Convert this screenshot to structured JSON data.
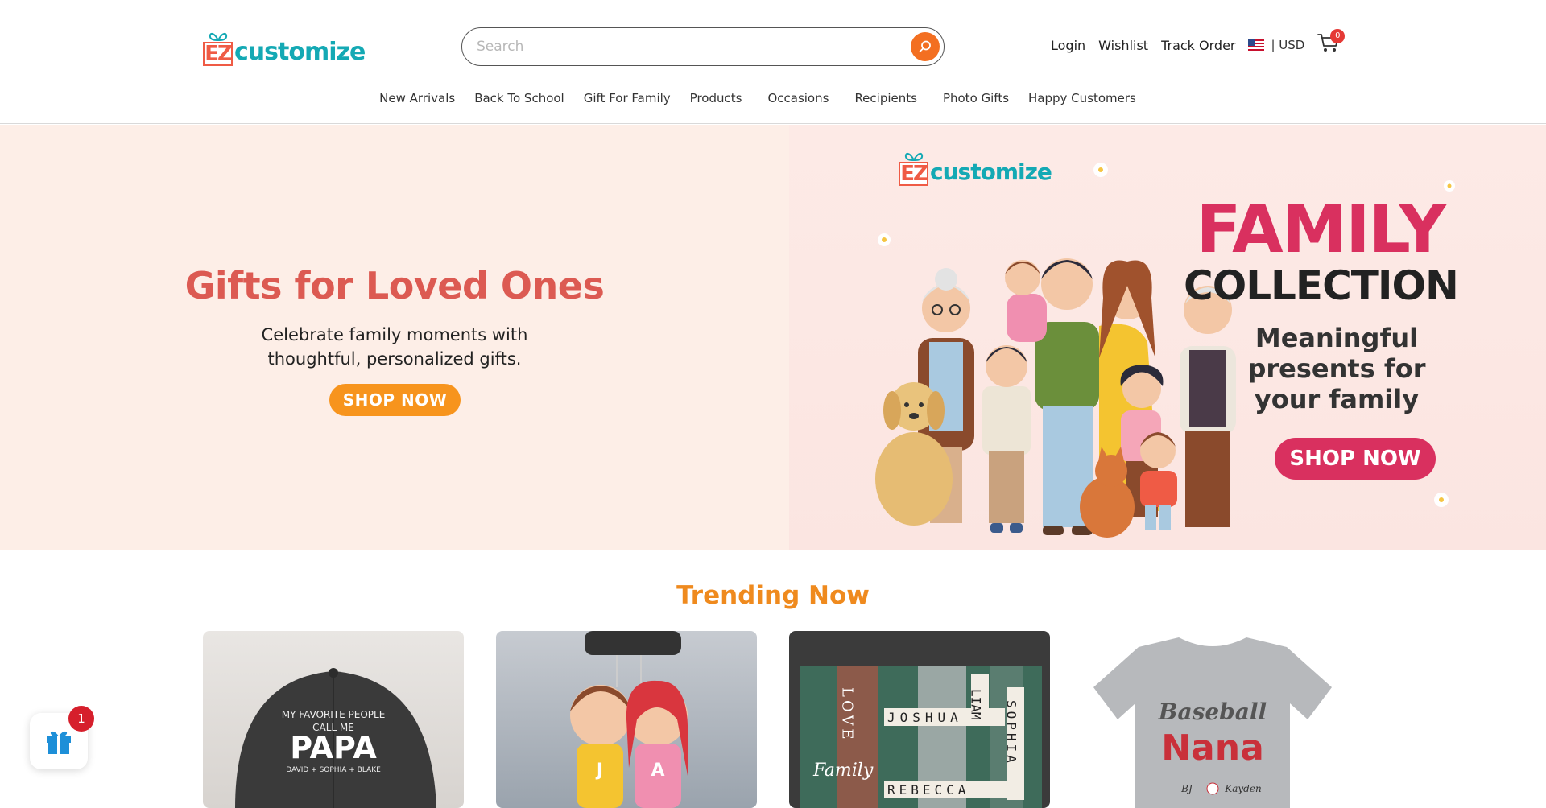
{
  "header": {
    "logo_text": "customize",
    "logo_mark": "EZ",
    "search_placeholder": "Search",
    "links": {
      "login": "Login",
      "wishlist": "Wishlist",
      "track_order": "Track Order",
      "currency": "| USD",
      "cart_count": "0"
    }
  },
  "nav": {
    "items": [
      {
        "label": "New Arrivals"
      },
      {
        "label": "Back To School"
      },
      {
        "label": "Gift For Family"
      },
      {
        "label": "Products"
      },
      {
        "label": "Occasions"
      },
      {
        "label": "Recipients"
      },
      {
        "label": "Photo Gifts"
      },
      {
        "label": "Happy Customers"
      }
    ]
  },
  "hero": {
    "title": "Gifts for Loved Ones",
    "subtitle_line1": "Celebrate family moments with",
    "subtitle_line2": "thoughtful, personalized gifts.",
    "button": "SHOP NOW",
    "banner": {
      "logo_mark": "EZ",
      "logo_text": "customize",
      "title": "FAMILY",
      "subtitle": "COLLECTION",
      "desc_line1": "Meaningful",
      "desc_line2": "presents for",
      "desc_line3": "your family",
      "button": "SHOP NOW"
    }
  },
  "trending": {
    "title": "Trending Now",
    "products": [
      {
        "image_text_line1": "MY FAVORITE PEOPLE",
        "image_text_line2": "CALL ME",
        "image_text_line3": "PAPA",
        "image_text_line4": "DAVID + SOPHIA + BLAKE"
      },
      {
        "image_text_line1": "J",
        "image_text_line2": "A"
      },
      {
        "image_text_line1": "LOVE",
        "image_text_line2": "Family",
        "image_text_line3": "JOSHUA",
        "image_text_line4": "REBECCA",
        "image_text_line5": "LIAM",
        "image_text_line6": "SOPHIA"
      },
      {
        "image_text_line1": "Baseball",
        "image_text_line2": "Nana",
        "image_text_line3": "BJ",
        "image_text_line4": "Kayden"
      }
    ]
  },
  "gift_widget": {
    "badge": "1"
  },
  "colors": {
    "brand_teal": "#14a9b4",
    "brand_red": "#ef5b45",
    "accent_orange": "#f7941d",
    "hero_title": "#dc5a52",
    "banner_pink": "#d9305f",
    "trending_orange": "#ef8a1e"
  }
}
